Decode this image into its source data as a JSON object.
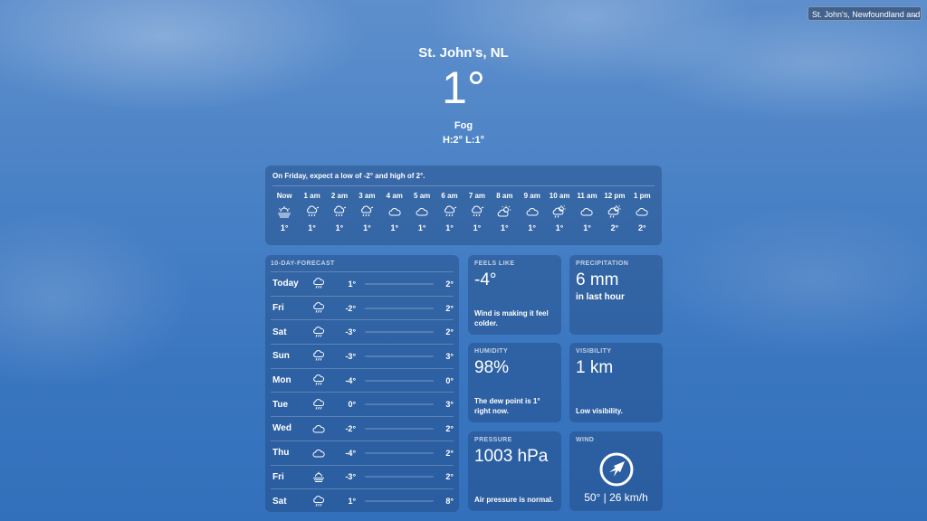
{
  "location_select": {
    "value": "St. John's, Newfoundland and"
  },
  "header": {
    "city": "St. John's, NL",
    "temp": "1°",
    "condition": "Fog",
    "high_low": "H:2° L:1°"
  },
  "hourly": {
    "summary": "On Friday, expect a low of -2° and high of 2°.",
    "hours": [
      {
        "time": "Now",
        "icon": "sun-fog-icon",
        "temp": "1°"
      },
      {
        "time": "1 am",
        "icon": "cloud-drizzle-icon",
        "temp": "1°"
      },
      {
        "time": "2 am",
        "icon": "cloud-drizzle-icon",
        "temp": "1°"
      },
      {
        "time": "3 am",
        "icon": "cloud-drizzle-icon",
        "temp": "1°"
      },
      {
        "time": "4 am",
        "icon": "cloud-icon",
        "temp": "1°"
      },
      {
        "time": "5 am",
        "icon": "cloud-icon",
        "temp": "1°"
      },
      {
        "time": "6 am",
        "icon": "cloud-drizzle-icon",
        "temp": "1°"
      },
      {
        "time": "7 am",
        "icon": "cloud-drizzle-icon",
        "temp": "1°"
      },
      {
        "time": "8 am",
        "icon": "sun-cloud-icon",
        "temp": "1°"
      },
      {
        "time": "9 am",
        "icon": "cloud-icon",
        "temp": "1°"
      },
      {
        "time": "10 am",
        "icon": "sun-cloud-drizzle-icon",
        "temp": "1°"
      },
      {
        "time": "11 am",
        "icon": "cloud-icon",
        "temp": "1°"
      },
      {
        "time": "12 pm",
        "icon": "sun-cloud-drizzle-icon",
        "temp": "2°"
      },
      {
        "time": "1 pm",
        "icon": "cloud-icon",
        "temp": "2°"
      }
    ]
  },
  "forecast": {
    "title": "10-DAY-FORECAST",
    "days": [
      {
        "day": "Today",
        "icon": "cloud-rain-icon",
        "low": "1°",
        "high": "2°"
      },
      {
        "day": "Fri",
        "icon": "cloud-rain-icon",
        "low": "-2°",
        "high": "2°"
      },
      {
        "day": "Sat",
        "icon": "cloud-rain-icon",
        "low": "-3°",
        "high": "2°"
      },
      {
        "day": "Sun",
        "icon": "cloud-rain-icon",
        "low": "-3°",
        "high": "3°"
      },
      {
        "day": "Mon",
        "icon": "cloud-rain-icon",
        "low": "-4°",
        "high": "0°"
      },
      {
        "day": "Tue",
        "icon": "cloud-rain-icon",
        "low": "0°",
        "high": "3°"
      },
      {
        "day": "Wed",
        "icon": "cloud-icon",
        "low": "-2°",
        "high": "2°"
      },
      {
        "day": "Thu",
        "icon": "cloud-icon",
        "low": "-4°",
        "high": "2°"
      },
      {
        "day": "Fri",
        "icon": "fog-icon",
        "low": "-3°",
        "high": "2°"
      },
      {
        "day": "Sat",
        "icon": "cloud-rain-icon",
        "low": "1°",
        "high": "8°"
      }
    ]
  },
  "tiles": {
    "feels_like": {
      "caption": "FEELS LIKE",
      "value": "-4°",
      "note": "Wind is making it feel colder."
    },
    "precipitation": {
      "caption": "PRECIPITATION",
      "value": "6 mm",
      "sub": "in last hour"
    },
    "humidity": {
      "caption": "HUMIDITY",
      "value": "98%",
      "note": "The dew point is 1° right now."
    },
    "visibility": {
      "caption": "VISIBILITY",
      "value": "1 km",
      "note": "Low visibility."
    },
    "pressure": {
      "caption": "PRESSURE",
      "value": "1003 hPa",
      "note": "Air pressure is normal."
    },
    "wind": {
      "caption": "WIND",
      "value": "50° | 26 km/h",
      "icon": "compass-icon"
    }
  }
}
